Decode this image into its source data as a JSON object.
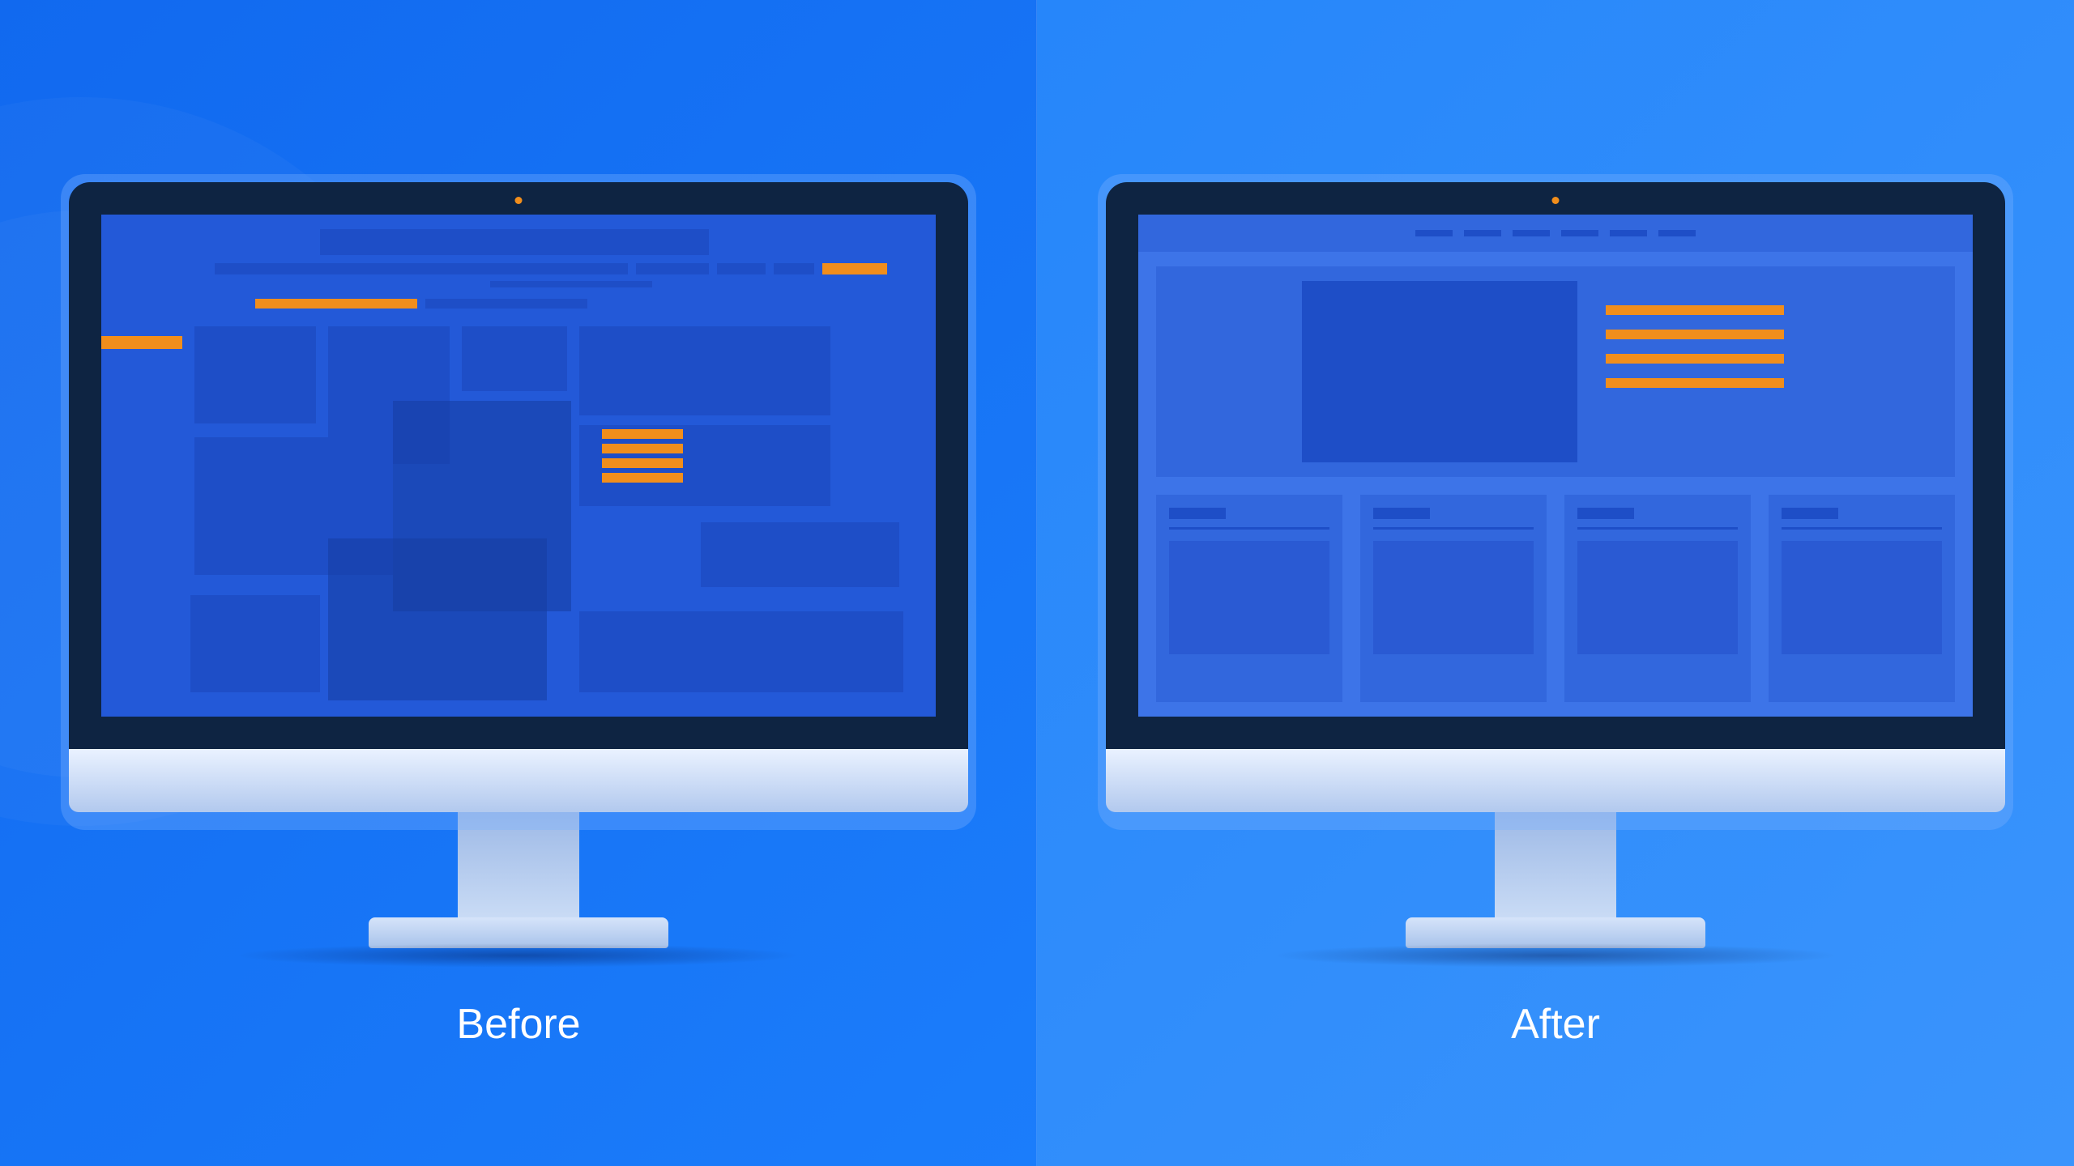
{
  "labels": {
    "before": "Before",
    "after": "After"
  },
  "colors": {
    "accent_orange": "#f18e1c",
    "block_dark": "#1e4ec7",
    "screen_before": "#2359d8",
    "screen_after": "#3d74e8",
    "frame": "#0e2442"
  },
  "description": "Side-by-side comparison illustration of two desktop monitors. Left ('Before') shows a cluttered, disorganized page layout with overlapping dark-blue and semi-transparent blocks and scattered orange highlight bars. Right ('After') shows a clean, structured layout with a top navigation bar, a hero section containing an image block and four orange text lines, and a row of four evenly-spaced content cards below."
}
